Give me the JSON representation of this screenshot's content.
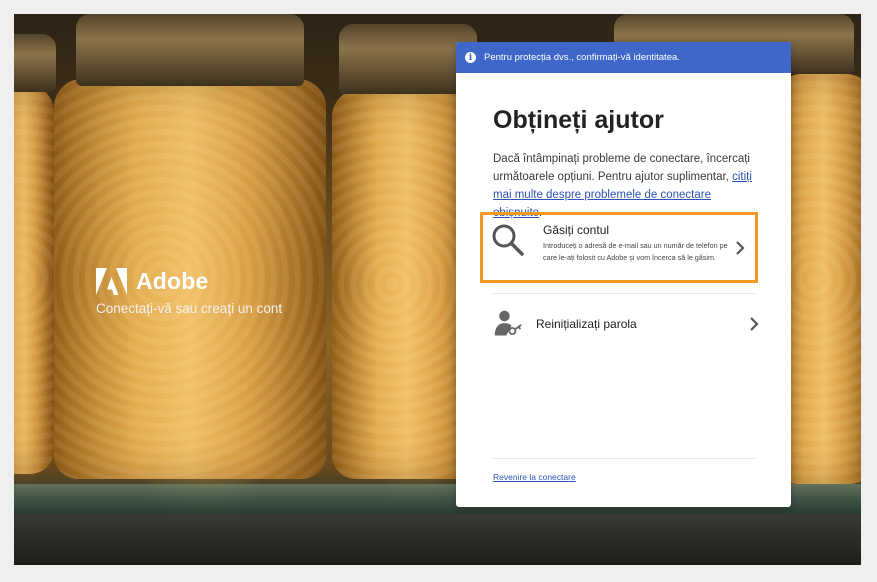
{
  "brand": {
    "name": "Adobe",
    "tagline": "Conectați-vă sau creați un cont"
  },
  "banner": {
    "text": "Pentru protecția dvs., confirmați-vă identitatea."
  },
  "panel": {
    "title": "Obțineți ajutor",
    "intro_text": "Dacă întâmpinați probleme de conectare, încercați următoarele opțiuni. Pentru ajutor suplimentar, ",
    "intro_link": "citiți mai multe despre problemele de conectare obișnuite",
    "intro_end": "."
  },
  "options": [
    {
      "title": "Găsiți contul",
      "description": "Introduceți o adresă de e-mail sau un număr de telefon pe care le-ați folosit cu Adobe și vom încerca să le găsim.",
      "icon": "search-icon"
    },
    {
      "title": "Reinițializați parola",
      "icon": "user-key-icon"
    }
  ],
  "footer": {
    "back_link": "Revenire la conectare"
  },
  "colors": {
    "banner": "#3f66c9",
    "highlight": "#f39a24",
    "link": "#2a54b5"
  }
}
